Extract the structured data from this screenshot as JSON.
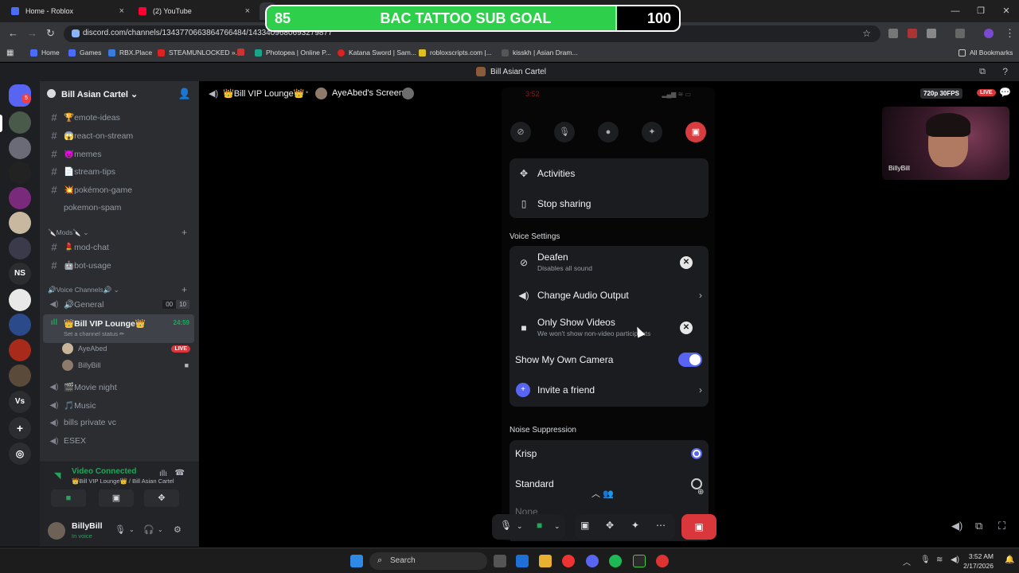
{
  "browser": {
    "tabs": [
      {
        "title": "Home - Roblox"
      },
      {
        "title": "(2) YouTube"
      }
    ],
    "url": "discord.com/channels/1343770663864766484/1433409680693279877",
    "bookmarks": [
      {
        "label": "Home"
      },
      {
        "label": "Games"
      },
      {
        "label": "RBX.Place"
      },
      {
        "label": "STEAMUNLOCKED »..."
      },
      {
        "label": "Photopea | Online P..."
      },
      {
        "label": "Katana Sword | Sam..."
      },
      {
        "label": "robloxscripts.com |..."
      },
      {
        "label": "kisskh | Asian Dram..."
      },
      {
        "label": "All Bookmarks"
      }
    ]
  },
  "goal": {
    "current": "85",
    "title": "BAC TATTOO SUB GOAL",
    "target": "100",
    "progress": 0.85
  },
  "discord": {
    "window_title": "Bill Asian Cartel",
    "rail_badge": "5",
    "rail_ns": "NS",
    "rail_vs": "Vs",
    "server_name": "Bill Asian Cartel",
    "channels": [
      {
        "name": "🏆emote-ideas"
      },
      {
        "name": "😱react-on-stream"
      },
      {
        "name": "😈memes"
      },
      {
        "name": "📄stream-tips"
      },
      {
        "name": "💥pokémon-game"
      },
      {
        "name": "pokemon-spam"
      }
    ],
    "mods_category": "🔪Mods🔪",
    "mod_channels": [
      {
        "name": "💄mod-chat"
      },
      {
        "name": "🤖bot-usage"
      }
    ],
    "voice_category": "🔊Voice Channels🔊",
    "voice_channels": {
      "general": "🔊General",
      "general_count_a": "00",
      "general_count_b": "10",
      "vip": "👑Bill VIP Lounge👑",
      "vip_time": "24:59",
      "vip_status": "Set a channel status ✏",
      "users": [
        {
          "name": "AyeAbed",
          "badge": "LIVE"
        },
        {
          "name": "BillyBill"
        }
      ],
      "movie": "🎬Movie night",
      "music": "🎵Music",
      "private": "bills private vc",
      "esex": "ESEX"
    },
    "voice_connected": {
      "label": "Video Connected",
      "sub": "👑Bill VIP Lounge👑 / Bill Asian Cartel"
    },
    "user": {
      "name": "BillyBill",
      "status": "In voice"
    },
    "stage": {
      "channel": "👑Bill VIP Lounge👑",
      "screen": "AyeAbed's Screen",
      "quality": "720p 30FPS",
      "live": "LIVE",
      "cam_name": "BillyBill"
    },
    "phone": {
      "clock": "3:52",
      "items": [
        {
          "label": "Activities"
        },
        {
          "label": "Stop sharing"
        }
      ],
      "voice_settings_title": "Voice Settings",
      "voice": [
        {
          "label": "Deafen",
          "sub": "Disables all sound"
        },
        {
          "label": "Change Audio Output"
        },
        {
          "label": "Only Show Videos",
          "sub": "We won't show non-video participants"
        },
        {
          "label": "Show My Own Camera"
        },
        {
          "label": "Invite a friend"
        }
      ],
      "noise_title": "Noise Suppression",
      "noise": [
        {
          "label": "Krisp"
        },
        {
          "label": "Standard"
        },
        {
          "label": "None"
        }
      ]
    }
  },
  "taskbar": {
    "search": "Search",
    "time": "3:52 AM",
    "date": "2/17/2026"
  },
  "colors": {
    "discord_blurple": "#5865f2",
    "live_red": "#da373c",
    "connected_green": "#23a55a",
    "goal_green": "#2ed04b"
  }
}
